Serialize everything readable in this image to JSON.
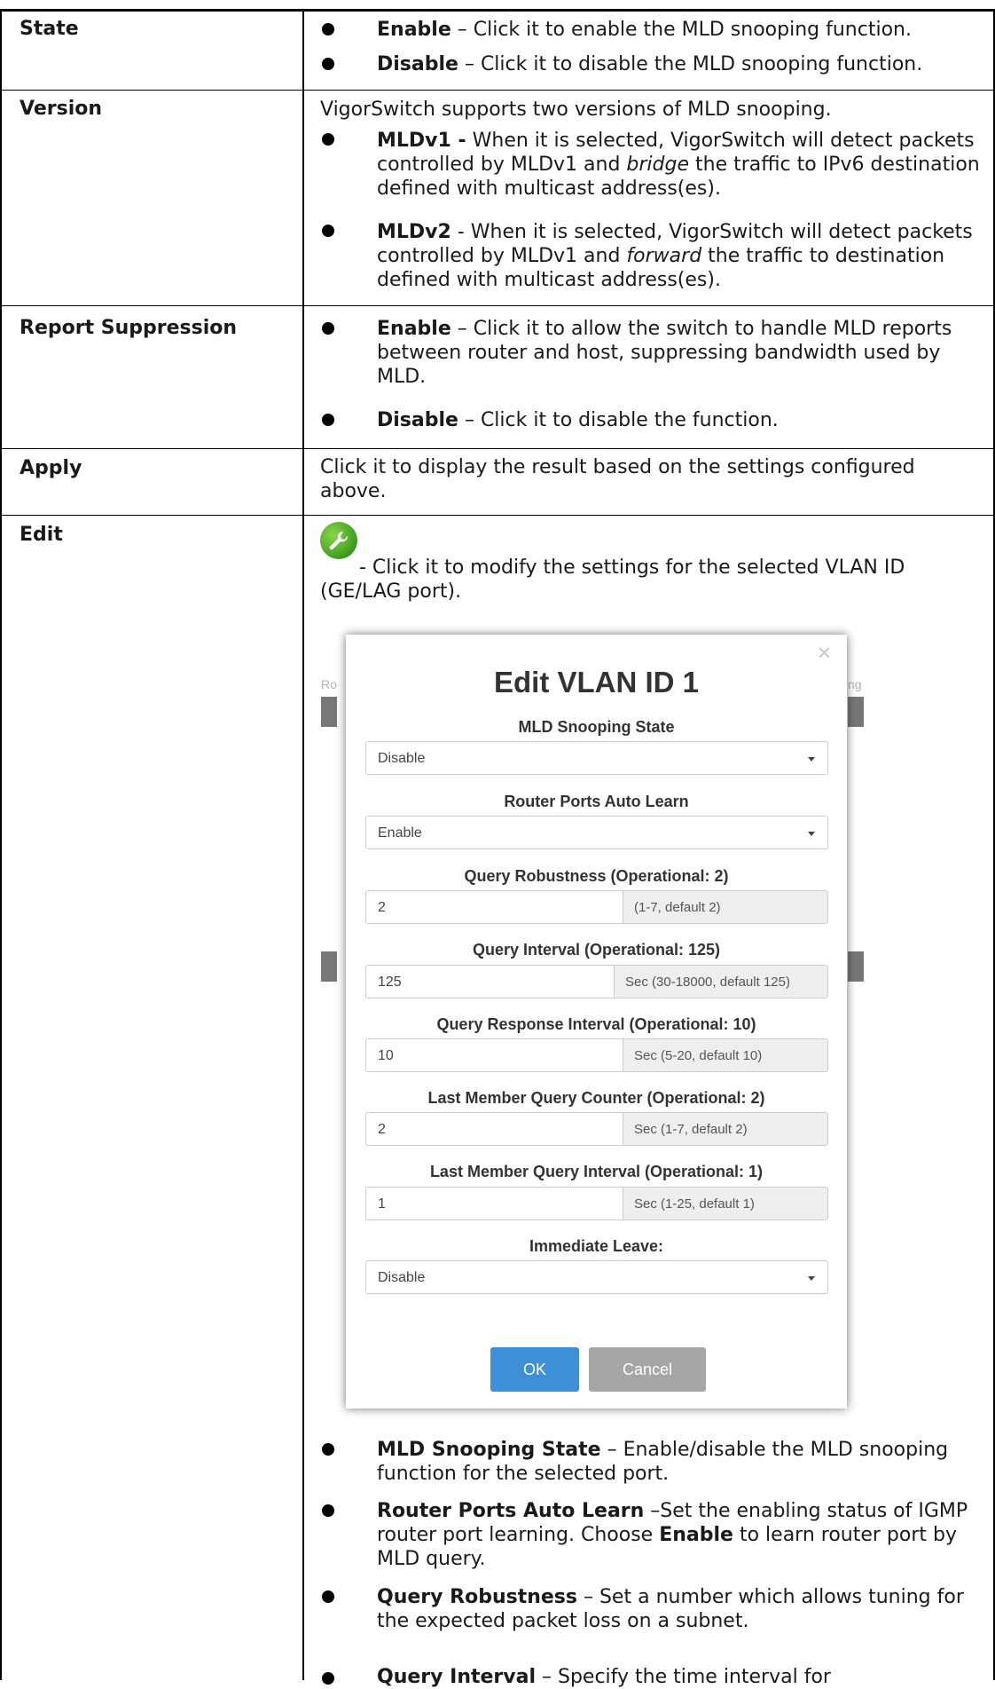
{
  "rows": {
    "state": {
      "label": "State",
      "b1_bold": "Enable",
      "b1_text": " – Click it to enable the MLD snooping function.",
      "b2_bold": "Disable",
      "b2_text": " – Click it to disable the MLD snooping function."
    },
    "version": {
      "label": "Version",
      "intro": "VigorSwitch supports two versions of MLD snooping.",
      "b1_bold": "MLDv1 -",
      "b1_text_a": " When it is selected, VigorSwitch will detect packets controlled by MLDv1 and ",
      "b1_italic": "bridge",
      "b1_text_b": " the traffic to IPv6 destination defined with multicast address(es).",
      "b2_bold": "MLDv2",
      "b2_text_a": " - When it is selected, VigorSwitch will detect packets controlled by MLDv1 and ",
      "b2_italic": "forward",
      "b2_text_b": " the traffic to destination defined with multicast address(es)."
    },
    "report": {
      "label": "Report Suppression",
      "b1_bold": "Enable",
      "b1_text": " – Click it to allow the switch to handle MLD reports between router and host, suppressing bandwidth used by MLD.",
      "b2_bold": "Disable",
      "b2_text": " – Click it to disable the function."
    },
    "apply": {
      "label": "Apply",
      "text": "Click it to display the result based on the settings configured above."
    },
    "edit": {
      "label": "Edit",
      "icon_text": "- Click it to modify the settings for the selected VLAN ID (GE/LAG port).",
      "bullets": [
        {
          "bold": "MLD Snooping State",
          "text": " – Enable/disable the MLD snooping function for the selected port."
        },
        {
          "bold": "Router Ports Auto Learn",
          "text_a": " –Set the enabling status of IGMP router port learning. Choose ",
          "bold2": "Enable",
          "text_b": " to learn router port by MLD query."
        },
        {
          "bold": "Query Robustness",
          "text": " – Set a number which allows tuning for the expected packet loss on a subnet."
        },
        {
          "bold": "Query Interval",
          "text": " – Specify the time interval for"
        }
      ]
    }
  },
  "dialog": {
    "title": "Edit VLAN ID 1",
    "close": "×",
    "bg_left": "Ro",
    "bg_right": "ng",
    "fields": {
      "snooping_state": {
        "label": "MLD Snooping State",
        "value": "Disable"
      },
      "auto_learn": {
        "label": "Router Ports Auto Learn",
        "value": "Enable"
      },
      "robustness": {
        "label": "Query Robustness (Operational: 2)",
        "value": "2",
        "hint": "(1-7, default 2)"
      },
      "interval": {
        "label": "Query Interval (Operational: 125)",
        "value": "125",
        "hint": "Sec (30-18000, default 125)"
      },
      "response": {
        "label": "Query Response Interval (Operational: 10)",
        "value": "10",
        "hint": "Sec (5-20, default 10)"
      },
      "lmq_counter": {
        "label": "Last Member Query Counter (Operational: 2)",
        "value": "2",
        "hint": "Sec (1-7, default 2)"
      },
      "lmq_interval": {
        "label": "Last Member Query Interval (Operational: 1)",
        "value": "1",
        "hint": "Sec (1-25, default 1)"
      },
      "immediate_leave": {
        "label": "Immediate Leave:",
        "value": "Disable"
      }
    },
    "ok": "OK",
    "cancel": "Cancel"
  },
  "colors": {
    "ok": "#3d8fd8",
    "cancel": "#a6a6a6",
    "wrench": "#4caf28"
  },
  "icons": {
    "edit": "wrench-icon",
    "dropdown": "chevron-down-icon",
    "bullet": "bullet-icon"
  }
}
